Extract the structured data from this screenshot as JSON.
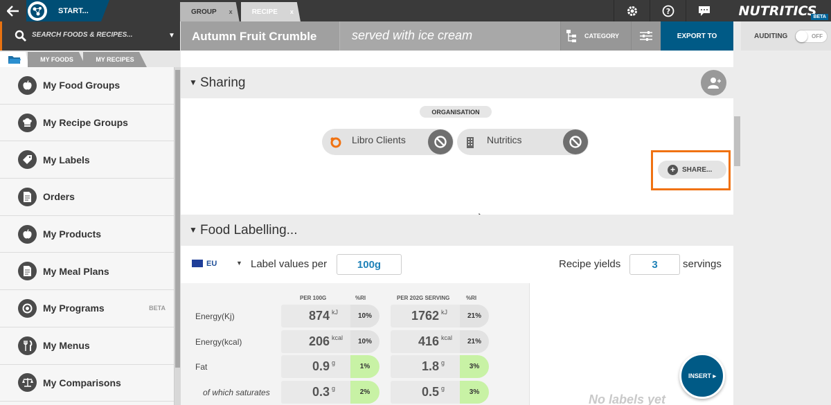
{
  "topbar": {
    "start_label": "START...",
    "tabs": [
      {
        "label": "GROUP",
        "close": "x"
      },
      {
        "label": "RECIPE",
        "close": "x"
      }
    ],
    "brand": "NUTRITICS",
    "brand_badge": "BETA",
    "icons": [
      "gear-icon",
      "help-icon",
      "chat-icon"
    ]
  },
  "search": {
    "placeholder": "SEARCH FOODS & RECIPES..."
  },
  "sidebar": {
    "tabs": [
      "MY FOODS",
      "MY RECIPES"
    ],
    "items": [
      {
        "label": "My Food Groups",
        "icon": "apple-icon"
      },
      {
        "label": "My Recipe Groups",
        "icon": "chef-hat-icon"
      },
      {
        "label": "My Labels",
        "icon": "tag-icon"
      },
      {
        "label": "Orders",
        "icon": "document-icon"
      },
      {
        "label": "My Products",
        "icon": "apple-icon"
      },
      {
        "label": "My Meal Plans",
        "icon": "document-icon"
      },
      {
        "label": "My Programs",
        "icon": "program-icon",
        "badge": "BETA"
      },
      {
        "label": "My Menus",
        "icon": "cutlery-icon"
      },
      {
        "label": "My Comparisons",
        "icon": "scales-icon"
      }
    ]
  },
  "header": {
    "title": "Autumn Fruit Crumble",
    "subtitle": "served with ice cream",
    "category_label": "CATEGORY",
    "export_label": "EXPORT TO"
  },
  "auditing": {
    "label": "AUDITING",
    "toggle_text": "OFF"
  },
  "sharing": {
    "section_title": "Sharing",
    "org_label": "ORGANISATION",
    "chips": [
      {
        "label": "Libro Clients",
        "icon": "libro-logo-icon"
      },
      {
        "label": "Nutritics",
        "icon": "building-icon"
      }
    ],
    "share_button": "SHARE..."
  },
  "labelling": {
    "section_title": "Food Labelling...",
    "region": "EU",
    "label_values_per": "Label values per",
    "per_value": "100g",
    "recipe_yields": "Recipe yields",
    "yield_value": "3",
    "servings": "servings",
    "columns": {
      "per100": "PER 100G",
      "ri": "%RI",
      "perserv": "PER 202G SERVING",
      "ri2": "%RI"
    },
    "rows": [
      {
        "name": "Energy(Kj)",
        "v100": "874",
        "u100": "kJ",
        "ri100": "10%",
        "vs": "1762",
        "us": "kJ",
        "ris": "21%",
        "ri_color": "#e2e2e2",
        "ris_color": "#e2e2e2"
      },
      {
        "name": "Energy(kcal)",
        "v100": "206",
        "u100": "kcal",
        "ri100": "10%",
        "vs": "416",
        "us": "kcal",
        "ris": "21%",
        "ri_color": "#e2e2e2",
        "ris_color": "#e2e2e2"
      },
      {
        "name": "Fat",
        "v100": "0.9",
        "u100": "g",
        "ri100": "1%",
        "vs": "1.8",
        "us": "g",
        "ris": "3%",
        "ri_color": "#c8f2a5",
        "ris_color": "#c8f2a5"
      },
      {
        "name": "of which saturates",
        "v100": "0.3",
        "u100": "g",
        "ri100": "2%",
        "vs": "0.5",
        "us": "g",
        "ris": "3%",
        "ri_color": "#c8f2a5",
        "ris_color": "#c8f2a5"
      }
    ],
    "no_labels": "No labels yet"
  },
  "insert_button": "INSERT ▸",
  "colors": {
    "accent_blue": "#005a86",
    "highlight_orange": "#f07212",
    "value_blue": "#1f82b8"
  }
}
